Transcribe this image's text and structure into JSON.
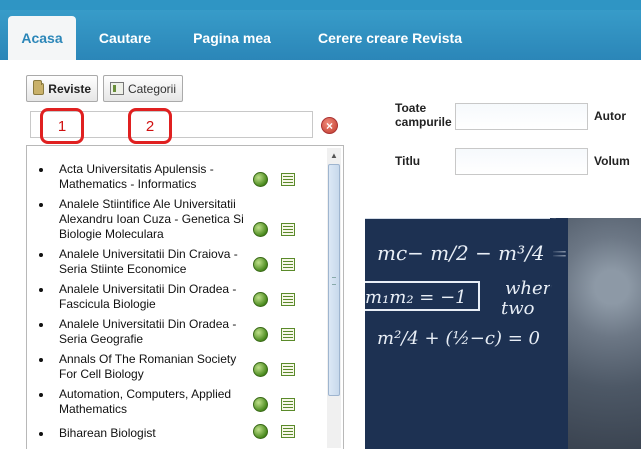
{
  "nav": {
    "tabs": [
      {
        "label": "Acasa"
      },
      {
        "label": "Cautare"
      },
      {
        "label": "Pagina mea"
      },
      {
        "label": "Cerere creare Revista"
      }
    ]
  },
  "left": {
    "reviste_label": "Reviste",
    "categorii_label": "Categorii",
    "search_value": "",
    "clear_glyph": "×",
    "callouts": [
      "1",
      "2"
    ],
    "items": [
      {
        "title": "Acta Universitatis Apulensis - Mathematics - Informatics"
      },
      {
        "title": "Analele Stiintifice Ale Universitatii Alexandru Ioan Cuza - Genetica Si Biologie Moleculara"
      },
      {
        "title": "Analele Universitatii Din Craiova - Seria Stiinte Economice"
      },
      {
        "title": "Analele Universitatii Din Oradea - Fascicula Biologie"
      },
      {
        "title": "Analele Universitatii Din Oradea - Seria Geografie"
      },
      {
        "title": "Annals Of The Romanian Society For Cell Biology"
      },
      {
        "title": "Automation, Computers, Applied Mathematics"
      },
      {
        "title": "Biharean Biologist"
      }
    ]
  },
  "right": {
    "toate_label_1": "Toate",
    "toate_label_2": "campurile",
    "autor_label": "Autor",
    "titlu_label": "Titlu",
    "volum_label": "Volum",
    "toate_value": "",
    "titlu_value": "",
    "math_lines": [
      "mc− m/2 − m³/4 =",
      "m₁m₂ = −1",
      "wher",
      "two",
      "m²/4 + (½−c) = 0"
    ]
  },
  "colors": {
    "nav_bg": "#2b86b8",
    "active_tab_text": "#2b86b8",
    "callout": "#e02020"
  }
}
